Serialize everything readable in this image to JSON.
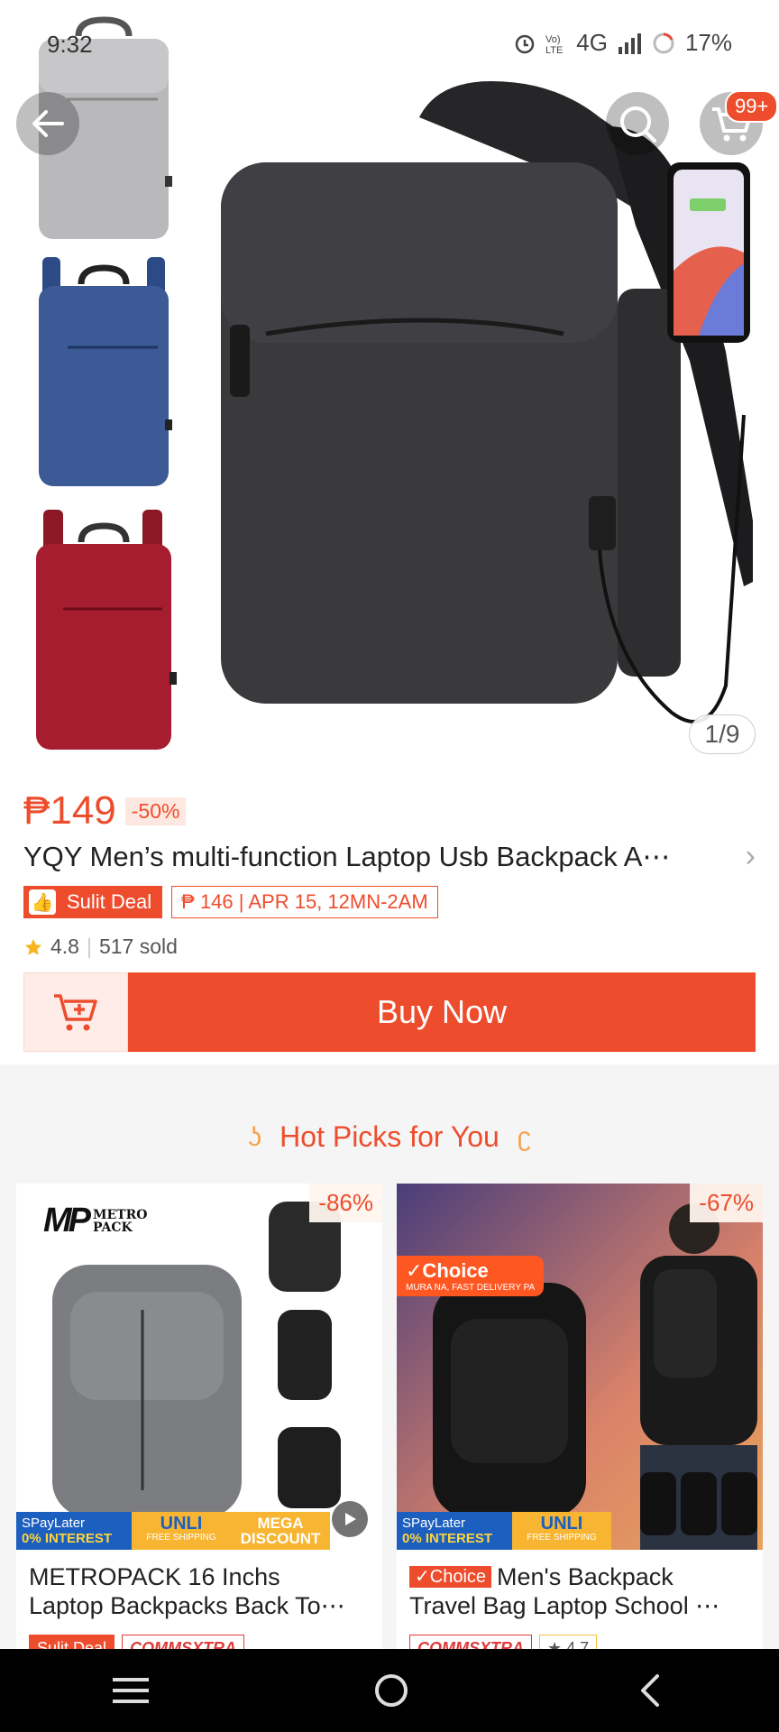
{
  "status_bar": {
    "time": "9:32",
    "network": "4G",
    "battery": "17%"
  },
  "gallery": {
    "counter": "1/9",
    "cart_badge": "99+"
  },
  "product": {
    "price": "₱149",
    "discount": "-50%",
    "title": "YQY Men’s multi-function Laptop Usb Backpack A⋯",
    "deal_label": "Sulit Deal",
    "flash_info": "₱ 146 | APR 15, 12MN-2AM",
    "rating": "4.8",
    "sold": "517 sold",
    "buy_label": "Buy Now"
  },
  "hot_picks": {
    "title": "Hot Picks for You",
    "items": [
      {
        "discount": "-86%",
        "brand_line1": "METRO",
        "brand_line2": "PACK",
        "title_line1": "METROPACK 16 Inchs",
        "title_line2": "Laptop Backpacks Back To⋯",
        "promo_spaylater": "SPayLater",
        "promo_interest": "0% INTEREST",
        "promo_unli": "UNLI",
        "promo_freeship": "FREE SHIPPING",
        "promo_mega": "MEGA",
        "promo_discount": "DISCOUNT",
        "badge1": "Sulit Deal",
        "badge2": "COMMSXTRA"
      },
      {
        "discount": "-67%",
        "ribbon_l1": "✓Choice",
        "ribbon_l2": "MURA NA, FAST DELIVERY PA",
        "choice_tag": "✓Choice",
        "title_line1": "Men's Backpack",
        "title_line2": "Travel Bag Laptop School ⋯",
        "promo_spaylater": "SPayLater",
        "promo_interest": "0% INTEREST",
        "promo_unli": "UNLI",
        "promo_freeship": "FREE SHIPPING",
        "badge1": "COMMSXTRA",
        "badge2": "★ 4.7"
      }
    ]
  },
  "colors": {
    "accent": "#ee4d2d",
    "background": "#f5f5f5"
  },
  "icons": [
    "back-arrow-icon",
    "search-icon",
    "cart-icon",
    "add-to-cart-icon",
    "star-icon",
    "menu-icon",
    "home-circle-icon",
    "back-chevron-icon",
    "play-icon"
  ]
}
